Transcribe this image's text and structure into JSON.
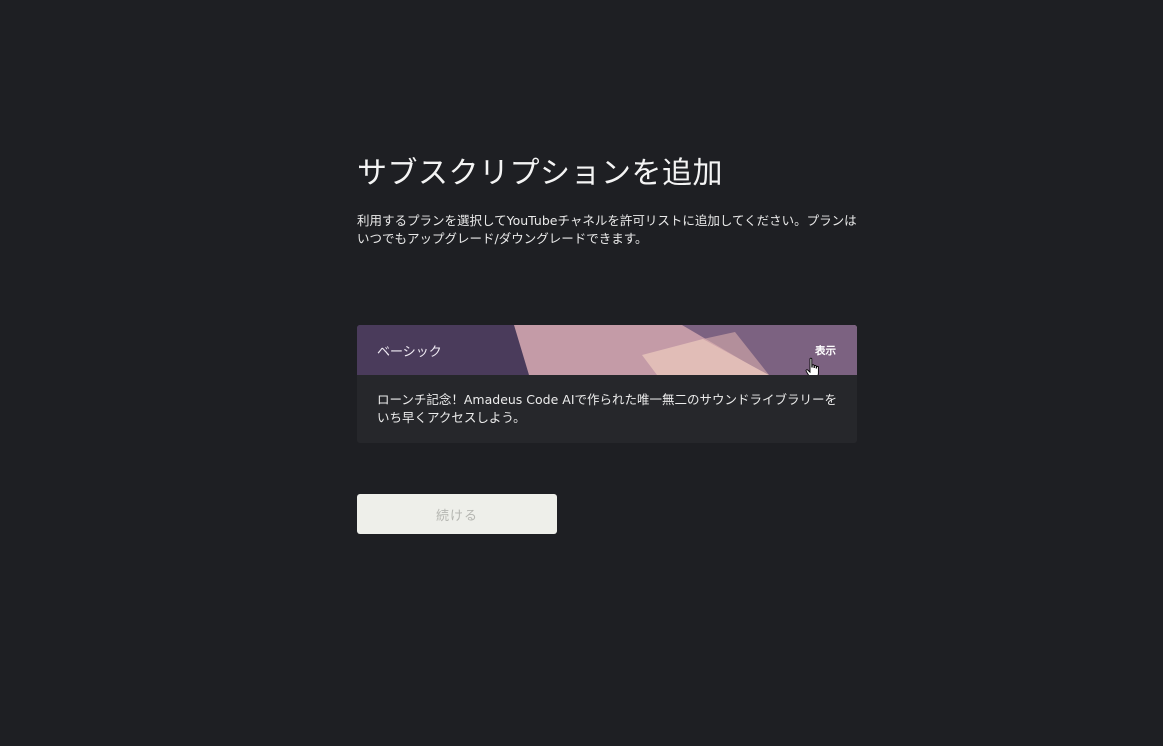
{
  "header": {
    "title": "サブスクリプションを追加",
    "description": "利用するプランを選択してYouTubeチャネルを許可リストに追加してください。プランはいつでもアップグレード/ダウングレードできます。"
  },
  "plan": {
    "name": "ベーシック",
    "show_label": "表示",
    "description": "ローンチ記念！Amadeus Code AIで作られた唯一無二のサウンドライブラリーをいち早くアクセスしよう。"
  },
  "actions": {
    "continue_label": "続ける"
  },
  "colors": {
    "background": "#1e1f23",
    "card": "#26272b",
    "plan_header": "#4a3b5b",
    "button": "#eeefea",
    "button_text": "#b5b6b1"
  },
  "icons": [
    "hand-pointer-icon"
  ]
}
